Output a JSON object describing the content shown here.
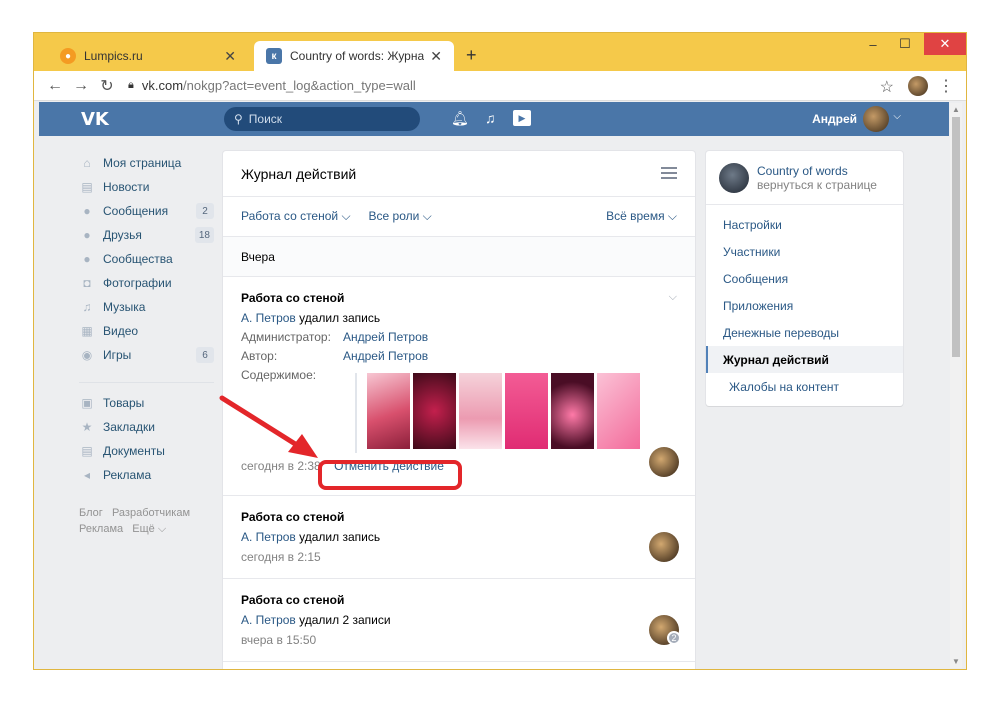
{
  "browser": {
    "tabs": [
      {
        "title": "Lumpics.ru",
        "favicon": "lumpics-favicon-icon"
      },
      {
        "title": "Country of words: Журнал дейст",
        "favicon": "vk-favicon-icon"
      }
    ],
    "url_host": "vk.com",
    "url_path": "/nokgp?act=event_log&action_type=wall"
  },
  "vk_header": {
    "logo": "VK",
    "search_placeholder": "Поиск",
    "user_name": "Андрей"
  },
  "sidebar": {
    "items": [
      {
        "label": "Моя страница",
        "icon": "home-icon",
        "glyph": "⌂",
        "count": ""
      },
      {
        "label": "Новости",
        "icon": "news-icon",
        "glyph": "▤",
        "count": ""
      },
      {
        "label": "Сообщения",
        "icon": "messages-icon",
        "glyph": "●",
        "count": "2"
      },
      {
        "label": "Друзья",
        "icon": "friends-icon",
        "glyph": "●",
        "count": "18"
      },
      {
        "label": "Сообщества",
        "icon": "communities-icon",
        "glyph": "●",
        "count": ""
      },
      {
        "label": "Фотографии",
        "icon": "photos-icon",
        "glyph": "◘",
        "count": ""
      },
      {
        "label": "Музыка",
        "icon": "music-icon",
        "glyph": "♫",
        "count": ""
      },
      {
        "label": "Видео",
        "icon": "video-icon",
        "glyph": "▦",
        "count": ""
      },
      {
        "label": "Игры",
        "icon": "games-icon",
        "glyph": "◉",
        "count": "6"
      }
    ],
    "items2": [
      {
        "label": "Товары",
        "icon": "goods-icon",
        "glyph": "▣"
      },
      {
        "label": "Закладки",
        "icon": "bookmarks-icon",
        "glyph": "★"
      },
      {
        "label": "Документы",
        "icon": "documents-icon",
        "glyph": "▤"
      },
      {
        "label": "Реклама",
        "icon": "ads-icon",
        "glyph": "◂"
      }
    ],
    "footer": {
      "blog": "Блог",
      "devs": "Разработчикам",
      "ads": "Реклама",
      "more": "Ещё ⌵"
    }
  },
  "main": {
    "title": "Журнал действий",
    "filter_action": "Работа со стеной ⌵",
    "filter_roles": "Все роли ⌵",
    "filter_time": "Всё время ⌵",
    "day_label": "Вчера",
    "entries": [
      {
        "title": "Работа со стеной",
        "actor": "А. Петров",
        "action": " удалил запись",
        "admin_label": "Администратор:",
        "admin_value": "Андрей Петров",
        "author_label": "Автор:",
        "author_value": "Андрей Петров",
        "content_label": "Содержимое:",
        "time": "сегодня в 2:38",
        "undo": "Отменить действие"
      },
      {
        "title": "Работа со стеной",
        "actor": "А. Петров",
        "action": " удалил запись",
        "time": "сегодня в 2:15"
      },
      {
        "title": "Работа со стеной",
        "actor": "А. Петров",
        "action": " удалил 2 записи",
        "time": "вчера в 15:50",
        "badge": "2"
      }
    ]
  },
  "right_panel": {
    "community_name": "Country of words",
    "back_link": "вернуться к странице",
    "menu": [
      {
        "label": "Настройки",
        "state": "normal"
      },
      {
        "label": "Участники",
        "state": "normal"
      },
      {
        "label": "Сообщения",
        "state": "normal"
      },
      {
        "label": "Приложения",
        "state": "normal"
      },
      {
        "label": "Денежные переводы",
        "state": "normal"
      },
      {
        "label": "Журнал действий",
        "state": "active"
      },
      {
        "label": "Жалобы на контент",
        "state": "sub"
      }
    ]
  },
  "colors": {
    "vk_blue": "#4a76a8",
    "link": "#2a5885",
    "highlight_red": "#e3262a",
    "chrome_yellow": "#f5c94a"
  }
}
